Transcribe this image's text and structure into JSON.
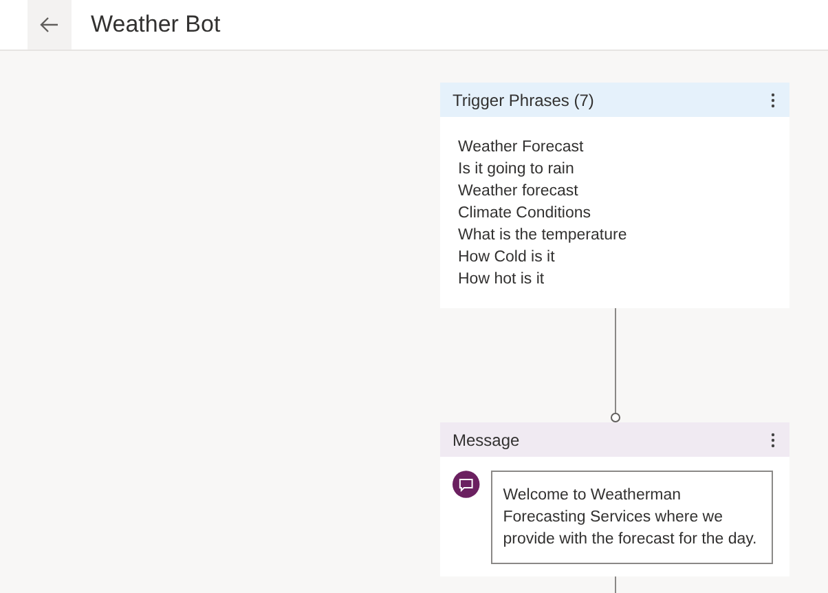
{
  "header": {
    "title": "Weather Bot"
  },
  "trigger_card": {
    "title": "Trigger Phrases (7)",
    "phrases": [
      "Weather Forecast",
      "Is it going to rain",
      "Weather forecast",
      "Climate Conditions",
      "What is the temperature",
      "How Cold is it",
      "How hot is it"
    ]
  },
  "message_card": {
    "title": "Message",
    "text": "Welcome to Weatherman Forecasting Services where we provide with the forecast for the day."
  }
}
